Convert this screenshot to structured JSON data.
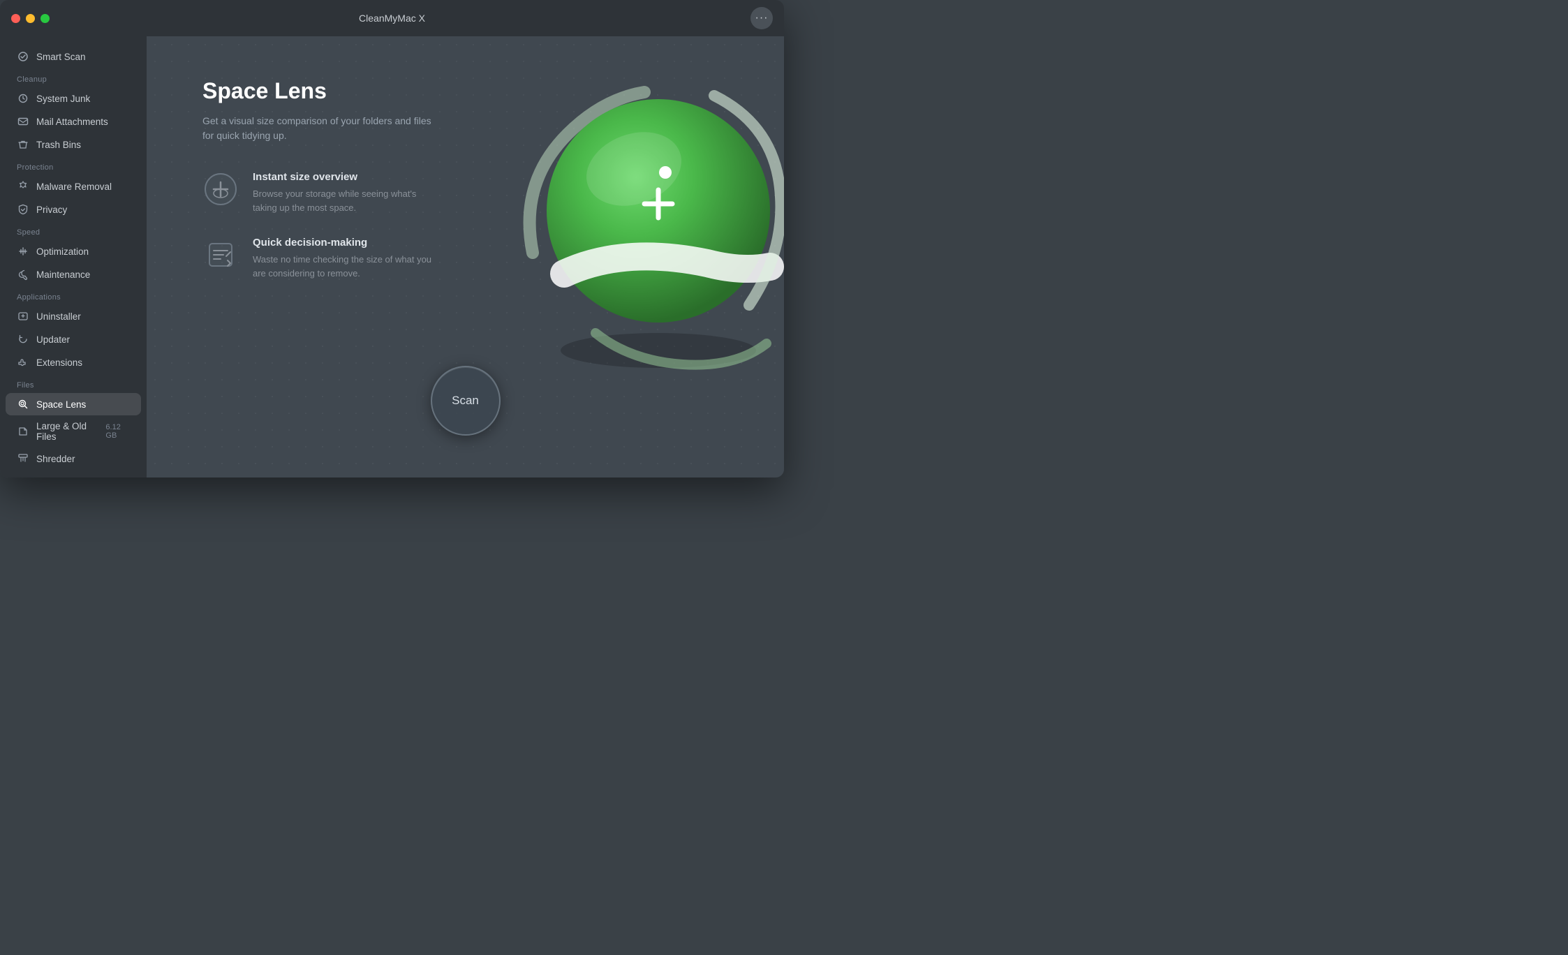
{
  "window": {
    "title": "CleanMyMac X"
  },
  "sidebar": {
    "smart_scan_label": "Smart Scan",
    "sections": [
      {
        "label": "Cleanup",
        "items": [
          {
            "id": "system-junk",
            "label": "System Junk",
            "icon": "system-junk"
          },
          {
            "id": "mail-attachments",
            "label": "Mail Attachments",
            "icon": "mail"
          },
          {
            "id": "trash-bins",
            "label": "Trash Bins",
            "icon": "trash"
          }
        ]
      },
      {
        "label": "Protection",
        "items": [
          {
            "id": "malware-removal",
            "label": "Malware Removal",
            "icon": "malware"
          },
          {
            "id": "privacy",
            "label": "Privacy",
            "icon": "privacy"
          }
        ]
      },
      {
        "label": "Speed",
        "items": [
          {
            "id": "optimization",
            "label": "Optimization",
            "icon": "optimization"
          },
          {
            "id": "maintenance",
            "label": "Maintenance",
            "icon": "maintenance"
          }
        ]
      },
      {
        "label": "Applications",
        "items": [
          {
            "id": "uninstaller",
            "label": "Uninstaller",
            "icon": "uninstaller"
          },
          {
            "id": "updater",
            "label": "Updater",
            "icon": "updater"
          },
          {
            "id": "extensions",
            "label": "Extensions",
            "icon": "extensions"
          }
        ]
      },
      {
        "label": "Files",
        "items": [
          {
            "id": "space-lens",
            "label": "Space Lens",
            "icon": "space-lens",
            "active": true
          },
          {
            "id": "large-old-files",
            "label": "Large & Old Files",
            "badge": "6.12 GB",
            "icon": "large-files"
          },
          {
            "id": "shredder",
            "label": "Shredder",
            "icon": "shredder"
          }
        ]
      }
    ]
  },
  "main": {
    "title": "Space Lens",
    "subtitle": "Get a visual size comparison of your folders and files\nfor quick tidying up.",
    "features": [
      {
        "id": "instant-size",
        "title": "Instant size overview",
        "description": "Browse your storage while seeing what's\ntaking up the most space."
      },
      {
        "id": "quick-decision",
        "title": "Quick decision-making",
        "description": "Waste no time checking the size of what you\nare considering to remove."
      }
    ],
    "scan_button_label": "Scan"
  }
}
